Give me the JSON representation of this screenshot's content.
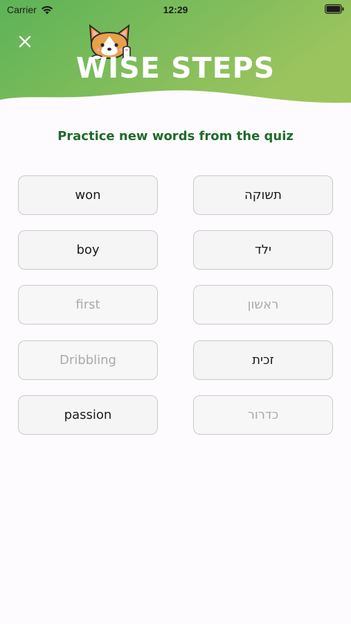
{
  "status_bar": {
    "carrier": "Carrier",
    "time": "12:29"
  },
  "header": {
    "logo_text": "WISE STEPS",
    "close_icon": "close-icon",
    "mascot_icon": "corgi-mascot-icon",
    "gradient_start": "#5cb357",
    "gradient_end": "#9cc45e"
  },
  "subtitle": "Practice new words from the quiz",
  "colors": {
    "subtitle": "#1f6b2a",
    "card_border": "#c9c9c9",
    "card_bg": "#f5f5f5",
    "matched_text": "#a9a9a9"
  },
  "english_words": [
    {
      "word": "won",
      "matched": false
    },
    {
      "word": "boy",
      "matched": false
    },
    {
      "word": "first",
      "matched": true
    },
    {
      "word": "Dribbling",
      "matched": true
    },
    {
      "word": "passion",
      "matched": false
    }
  ],
  "hebrew_words": [
    {
      "word": "תשוקה",
      "matched": false
    },
    {
      "word": "ילד",
      "matched": false
    },
    {
      "word": "ראשון",
      "matched": true
    },
    {
      "word": "זכית",
      "matched": false
    },
    {
      "word": "כדרור",
      "matched": true
    }
  ]
}
